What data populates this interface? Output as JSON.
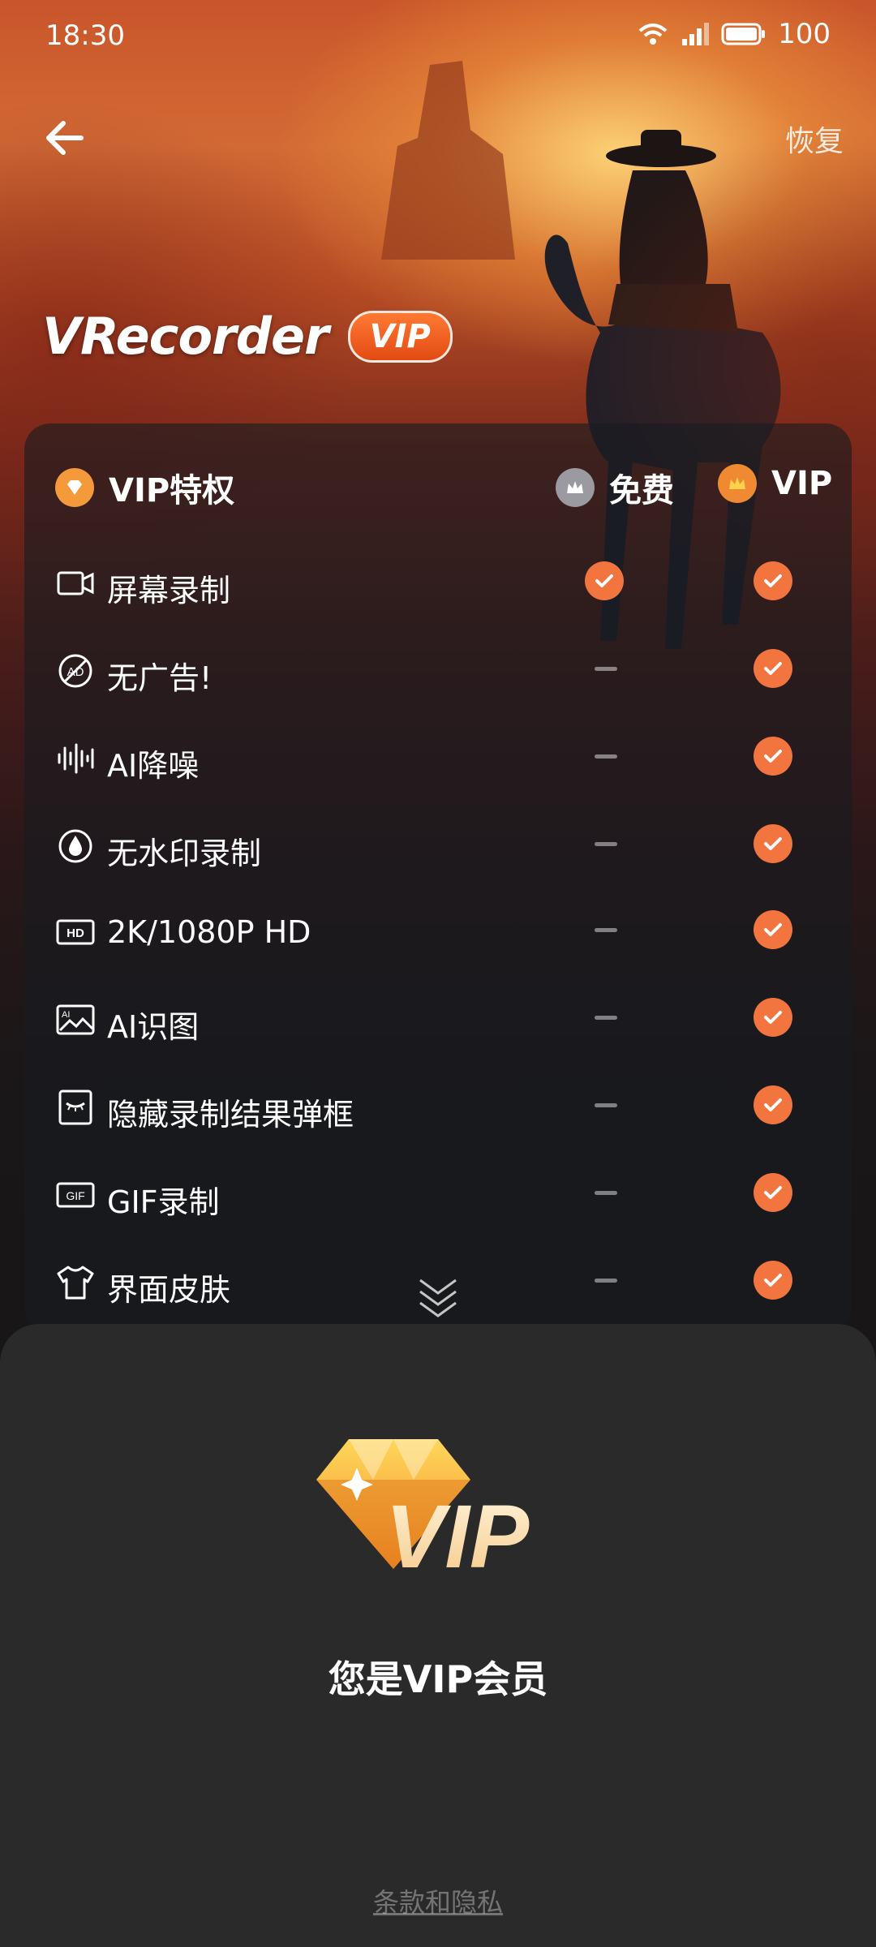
{
  "status_bar": {
    "time": "18:30",
    "battery": "100"
  },
  "nav": {
    "restore_label": "恢复"
  },
  "brand": {
    "name": "VRecorder",
    "badge": "VIP"
  },
  "features": {
    "header": {
      "title": "VIP特权",
      "free": "免费",
      "vip": "VIP"
    },
    "rows": [
      {
        "label": "屏幕录制",
        "icon": "video-camera-icon",
        "free": true,
        "vip": true
      },
      {
        "label": "无广告!",
        "icon": "no-ads-icon",
        "free": false,
        "vip": true
      },
      {
        "label": "AI降噪",
        "icon": "waveform-icon",
        "free": false,
        "vip": true
      },
      {
        "label": "无水印录制",
        "icon": "watermark-drop-icon",
        "free": false,
        "vip": true
      },
      {
        "label": "2K/1080P HD",
        "icon": "hd-icon",
        "free": false,
        "vip": true
      },
      {
        "label": "AI识图",
        "icon": "ai-image-icon",
        "free": false,
        "vip": true
      },
      {
        "label": "隐藏录制结果弹框",
        "icon": "hidden-eye-icon",
        "free": false,
        "vip": true
      },
      {
        "label": "GIF录制",
        "icon": "gif-icon",
        "free": false,
        "vip": true
      },
      {
        "label": "界面皮肤",
        "icon": "tshirt-icon",
        "free": false,
        "vip": true
      }
    ]
  },
  "sheet": {
    "logo_text": "VIP",
    "member_text": "您是VIP会员",
    "terms_label": "条款和隐私"
  },
  "colors": {
    "accent": "#f2743f",
    "sheet_bg": "#2a2a2a"
  }
}
